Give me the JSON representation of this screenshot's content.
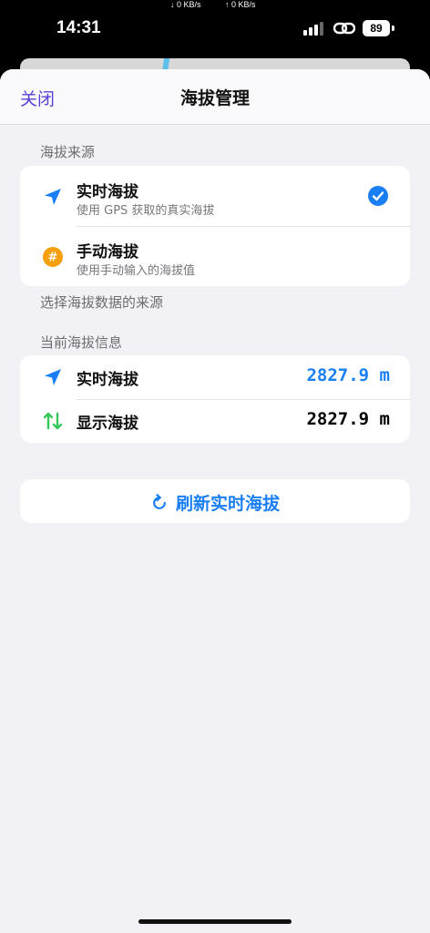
{
  "status_bar": {
    "time": "14:31",
    "download_speed": "↓ 0 KB/s",
    "upload_speed": "↑ 0 KB/s",
    "battery": "89"
  },
  "nav": {
    "close_label": "关闭",
    "title": "海拔管理"
  },
  "source_section": {
    "header": "海拔来源",
    "footer": "选择海拔数据的来源",
    "options": [
      {
        "title": "实时海拔",
        "subtitle": "使用 GPS 获取的真实海拔",
        "icon": "location-arrow-icon",
        "selected": true
      },
      {
        "title": "手动海拔",
        "subtitle": "使用手动输入的海拔值",
        "icon": "number-sign-icon",
        "selected": false
      }
    ]
  },
  "info_section": {
    "header": "当前海拔信息",
    "rows": [
      {
        "label": "实时海拔",
        "value": "2827.9 m",
        "icon": "location-arrow-icon",
        "color": "#1a7ff5"
      },
      {
        "label": "显示海拔",
        "value": "2827.9 m",
        "icon": "swap-vertical-icon",
        "color": "#000000"
      }
    ]
  },
  "refresh_button": {
    "label": "刷新实时海拔",
    "icon": "refresh-icon"
  },
  "colors": {
    "accent": "#1a7ff5",
    "close": "#5a3fd6",
    "manual_badge": "#f59f0b",
    "swap_icon": "#34c759"
  }
}
